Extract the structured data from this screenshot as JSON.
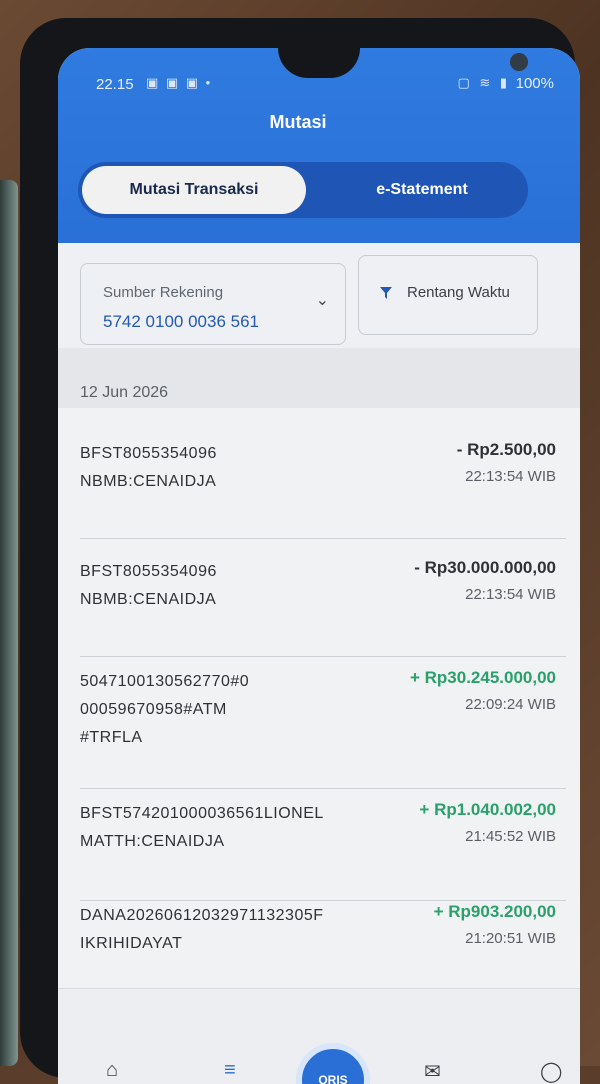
{
  "status_bar": {
    "time": "22.15",
    "battery": "100%"
  },
  "header": {
    "title": "Mutasi"
  },
  "tabs": [
    {
      "label": "Mutasi Transaksi",
      "active": true
    },
    {
      "label": "e-Statement",
      "active": false
    }
  ],
  "filters": {
    "source_label": "Sumber Rekening",
    "source_value": "5742 0100 0036 561",
    "time_label": "Rentang Waktu"
  },
  "date_group": "12 Jun 2026",
  "transactions": [
    {
      "desc_lines": [
        "BFST8055354096",
        "NBMB:CENAIDJA"
      ],
      "amount": "- Rp2.500,00",
      "time": "22:13:54 WIB",
      "type": "debit"
    },
    {
      "desc_lines": [
        "BFST8055354096",
        "NBMB:CENAIDJA"
      ],
      "amount": "- Rp30.000.000,00",
      "time": "22:13:54 WIB",
      "type": "debit"
    },
    {
      "desc_lines": [
        "5047100130562770#0",
        "00059670958#ATM",
        "#TRFLA"
      ],
      "amount": "+ Rp30.245.000,00",
      "time": "22:09:24 WIB",
      "type": "credit"
    },
    {
      "desc_lines": [
        "BFST574201000036561LIONEL",
        "MATTH:CENAIDJA"
      ],
      "amount": "+ Rp1.040.002,00",
      "time": "21:45:52 WIB",
      "type": "credit"
    },
    {
      "desc_lines": [
        "DANA20260612032971132305F",
        "IKRIHIDAYAT"
      ],
      "amount": "+ Rp903.200,00",
      "time": "21:20:51 WIB",
      "type": "credit"
    }
  ],
  "bottom_nav": {
    "qris_label": "QRIS"
  },
  "colors": {
    "header_blue": "#2f7be0",
    "tab_dark_blue": "#1f56b6",
    "credit_green": "#2aa06a",
    "account_blue": "#2359b7"
  },
  "icons": [
    "chevron-down-icon",
    "filter-icon",
    "home-icon",
    "list-icon",
    "qris-icon",
    "mail-icon",
    "profile-icon"
  ]
}
